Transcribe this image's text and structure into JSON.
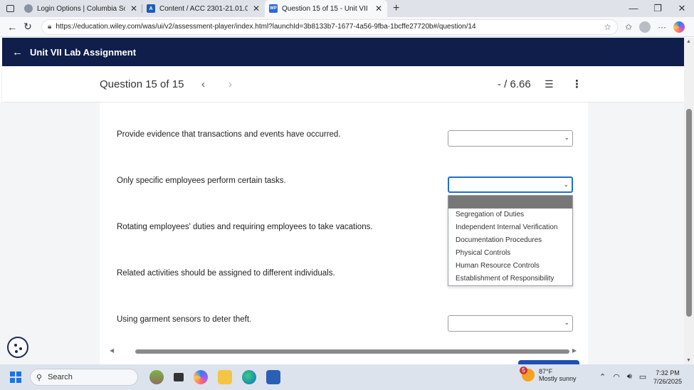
{
  "browser": {
    "tabs": [
      {
        "label": "Login Options | Columbia Southe",
        "favicon_color": "#8a93a3",
        "active": false
      },
      {
        "label": "Content / ACC 2301-21.01.01-18:",
        "favicon_color": "#1e5db6",
        "favicon_text": "A",
        "active": false
      },
      {
        "label": "Question 15 of 15 - Unit VII Lab A",
        "favicon_color": "#2a6bd6",
        "favicon_text": "WP",
        "active": true
      }
    ],
    "url": "https://education.wiley.com/was/ui/v2/assessment-player/index.html?launchId=3b8133b7-1677-4a56-9fba-1bcffe27720b#/question/14"
  },
  "app": {
    "header_title": "Unit VII Lab Assignment"
  },
  "question_bar": {
    "title": "Question 15 of 15",
    "score": "- / 6.66"
  },
  "questions": [
    {
      "text": "Provide evidence that transactions and events have occurred.",
      "selected": ""
    },
    {
      "text": "Only specific employees perform certain tasks.",
      "selected": ""
    },
    {
      "text": "Rotating employees' duties and requiring employees to take vacations.",
      "selected": ""
    },
    {
      "text": "Related activities should be assigned to different individuals.",
      "selected": ""
    },
    {
      "text": "Using garment sensors to deter theft.",
      "selected": ""
    }
  ],
  "dropdown_options": [
    "",
    "Segregation of Duties",
    "Independent Internal Verification",
    "Documentation Procedures",
    "Physical Controls",
    "Human Resource Controls",
    "Establishment of Responsibility"
  ],
  "taskbar": {
    "search_label": "Search",
    "weather_temp": "87°F",
    "weather_desc": "Mostly sunny",
    "weather_badge": "5",
    "time": "7:32 PM",
    "date": "7/26/2025"
  },
  "colors": {
    "header_bg": "#0f1e4a",
    "focus_blue": "#1f6fd1",
    "dropdown_highlight": "#777777"
  }
}
